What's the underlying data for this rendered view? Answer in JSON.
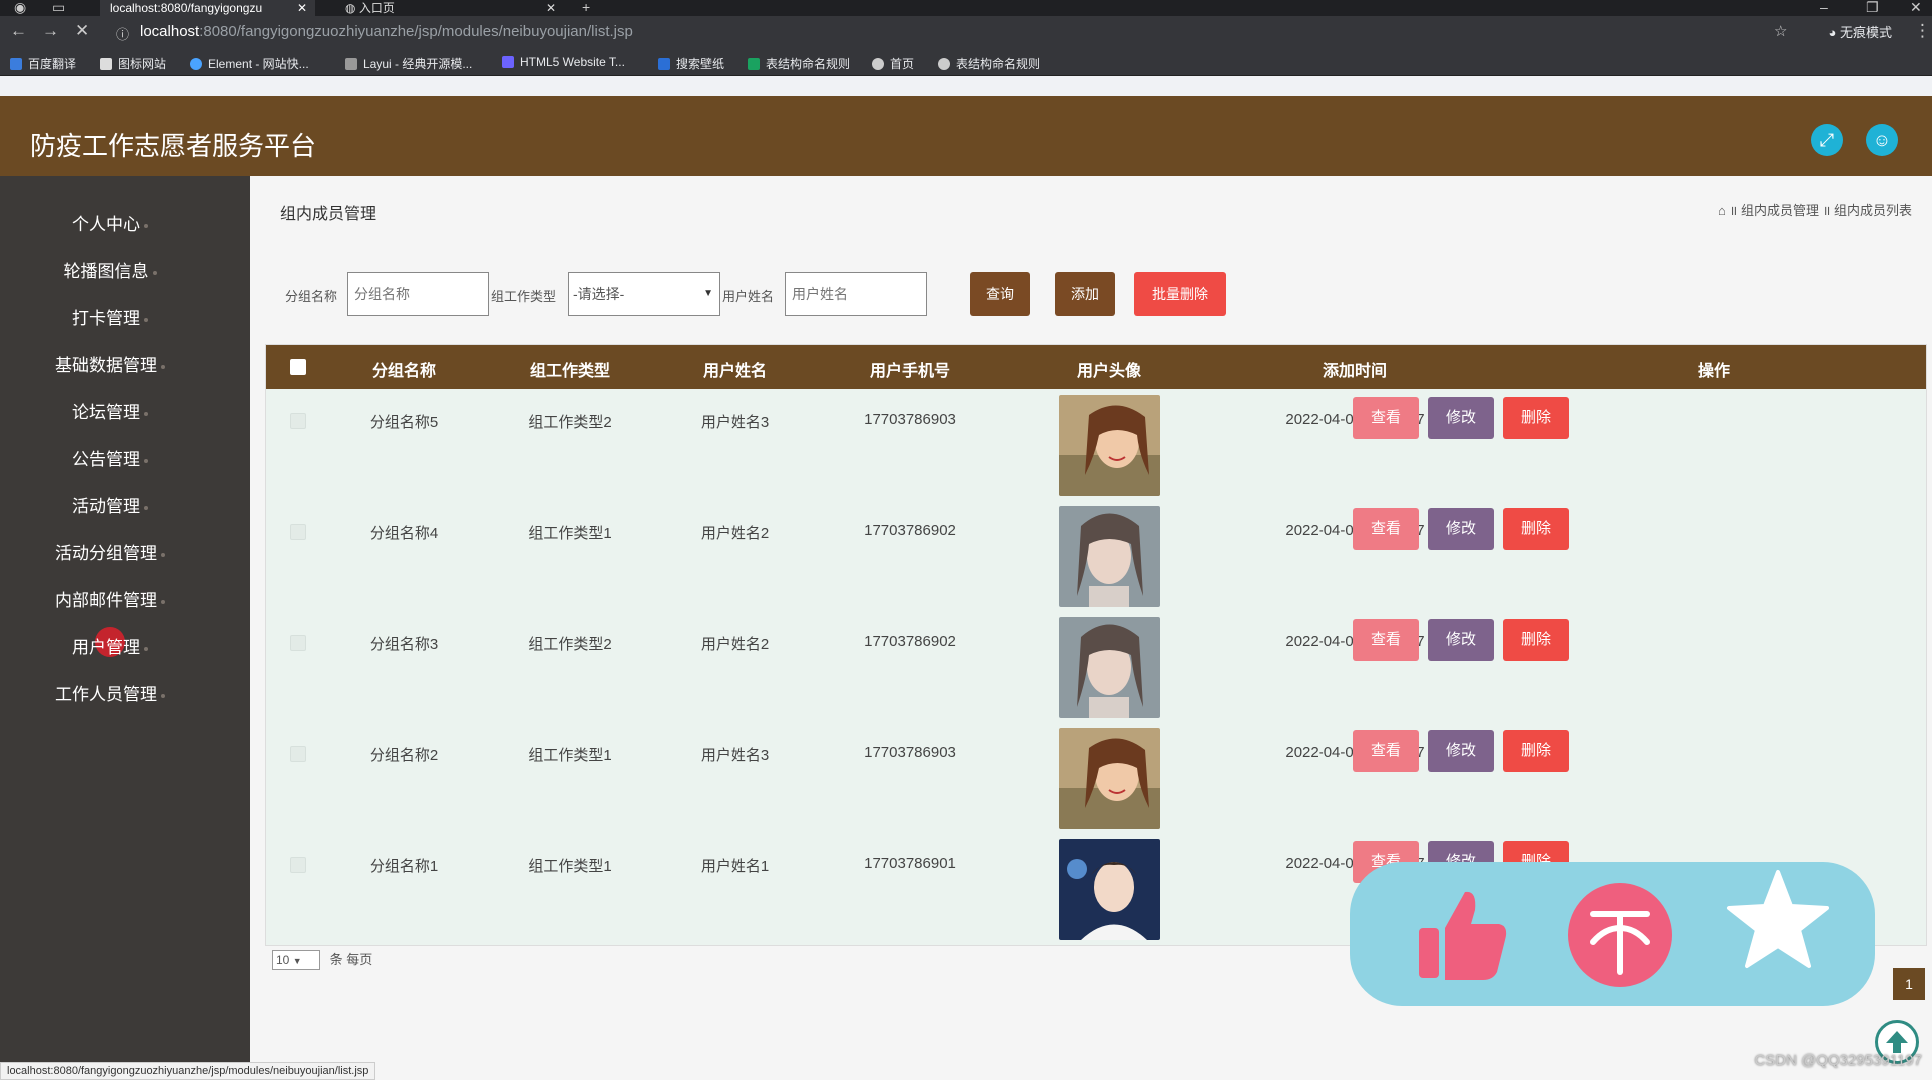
{
  "browser": {
    "tabs": [
      {
        "label": "localhost:8080/fangyigongzu",
        "active": true
      },
      {
        "label": "入口页",
        "active": false
      }
    ],
    "url_host": "localhost",
    "url_path": ":8080/fangyigongzuozhiyuanzhe/jsp/modules/neibuyoujian/list.jsp",
    "incognito_label": "无痕模式",
    "bookmarks": [
      "百度翻译",
      "图标网站",
      "Element - 网站快...",
      "Layui - 经典开源模...",
      "HTML5 Website T...",
      "搜索壁纸",
      "表结构命名规则",
      "首页",
      "表结构命名规则"
    ]
  },
  "app": {
    "title": "防疫工作志愿者服务平台"
  },
  "sidebar": {
    "items": [
      "个人中心",
      "轮播图信息",
      "打卡管理",
      "基础数据管理",
      "论坛管理",
      "公告管理",
      "活动管理",
      "活动分组管理",
      "内部邮件管理",
      "用户管理",
      "工作人员管理"
    ]
  },
  "page": {
    "title": "组内成员管理",
    "breadcrumb": [
      "组内成员管理",
      "组内成员列表"
    ]
  },
  "filters": {
    "group_label": "分组名称",
    "group_placeholder": "分组名称",
    "type_label": "组工作类型",
    "type_selected": "-请选择-",
    "user_label": "用户姓名",
    "user_placeholder": "用户姓名",
    "query_btn": "查询",
    "add_btn": "添加",
    "batch_delete_btn": "批量删除"
  },
  "table": {
    "headers": [
      "分组名称",
      "组工作类型",
      "用户姓名",
      "用户手机号",
      "用户头像",
      "添加时间",
      "操作"
    ],
    "rows": [
      {
        "group": "分组名称5",
        "type": "组工作类型2",
        "user": "用户姓名3",
        "phone": "17703786903",
        "time": "2022-04-04 20:51:17",
        "avatar": "woman-smiling"
      },
      {
        "group": "分组名称4",
        "type": "组工作类型1",
        "user": "用户姓名2",
        "phone": "17703786902",
        "time": "2022-04-04 20:51:17",
        "avatar": "woman-pensive"
      },
      {
        "group": "分组名称3",
        "type": "组工作类型2",
        "user": "用户姓名2",
        "phone": "17703786902",
        "time": "2022-04-04 20:51:17",
        "avatar": "woman-pensive"
      },
      {
        "group": "分组名称2",
        "type": "组工作类型1",
        "user": "用户姓名3",
        "phone": "17703786903",
        "time": "2022-04-04 20:51:17",
        "avatar": "woman-smiling"
      },
      {
        "group": "分组名称1",
        "type": "组工作类型1",
        "user": "用户姓名1",
        "phone": "17703786901",
        "time": "2022-04-04 20:51:17",
        "avatar": "man-portrait"
      }
    ],
    "actions": {
      "view": "查看",
      "edit": "修改",
      "delete": "删除"
    }
  },
  "pager": {
    "page_size": "10",
    "per_page_label": "条 每页",
    "current_page": "1"
  },
  "status_url": "localhost:8080/fangyigongzuozhiyuanzhe/jsp/modules/neibuyoujian/list.jsp",
  "watermark": "CSDN @QQ3295391197",
  "colors": {
    "header_brown": "#6b4a23",
    "sidebar": "#3d3a38",
    "view_btn": "#ef7b85",
    "edit_btn": "#7e638c",
    "delete_btn": "#ef4b45"
  }
}
